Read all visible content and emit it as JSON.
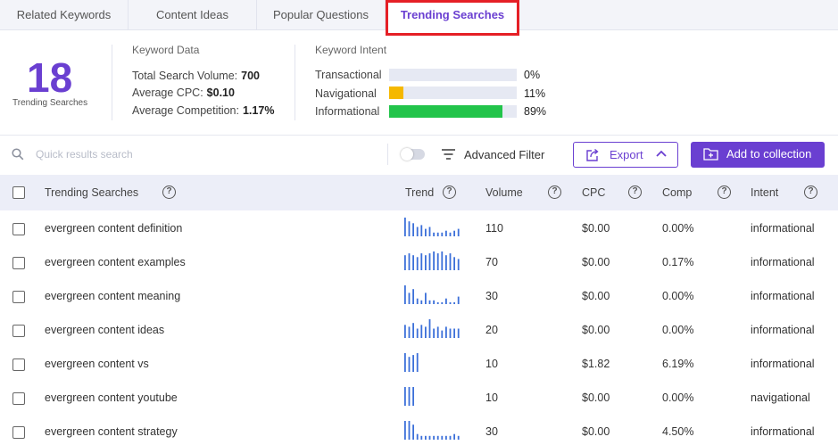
{
  "tabs": [
    {
      "label": "Related Keywords"
    },
    {
      "label": "Content Ideas"
    },
    {
      "label": "Popular Questions"
    },
    {
      "label": "Trending Searches"
    }
  ],
  "summary": {
    "count": "18",
    "label": "Trending Searches"
  },
  "keyword_data": {
    "title": "Keyword Data",
    "volume_label": "Total Search Volume:",
    "volume_value": "700",
    "cpc_label": "Average CPC:",
    "cpc_value": "$0.10",
    "comp_label": "Average Competition:",
    "comp_value": "1.17%"
  },
  "keyword_intent": {
    "title": "Keyword Intent",
    "items": [
      {
        "label": "Transactional",
        "pct": "0%",
        "fraction": 0.0,
        "color": "#f5b800"
      },
      {
        "label": "Navigational",
        "pct": "11%",
        "fraction": 0.11,
        "color": "#f5b800"
      },
      {
        "label": "Informational",
        "pct": "89%",
        "fraction": 0.89,
        "color": "#22c44a"
      }
    ]
  },
  "toolbar": {
    "search_placeholder": "Quick results search",
    "filter_label": "Advanced Filter",
    "export_label": "Export",
    "collection_label": "Add to collection"
  },
  "table": {
    "headers": {
      "keyword": "Trending Searches",
      "trend": "Trend",
      "volume": "Volume",
      "cpc": "CPC",
      "comp": "Comp",
      "intent": "Intent"
    },
    "rows": [
      {
        "keyword": "evergreen content definition",
        "volume": "110",
        "cpc": "$0.00",
        "comp": "0.00%",
        "intent": "informational",
        "trend": [
          10,
          8,
          7,
          5,
          6,
          4,
          5,
          2,
          2,
          2,
          3,
          2,
          3,
          4
        ]
      },
      {
        "keyword": "evergreen content examples",
        "volume": "70",
        "cpc": "$0.00",
        "comp": "0.17%",
        "intent": "informational",
        "trend": [
          8,
          9,
          8,
          7,
          9,
          8,
          9,
          10,
          9,
          10,
          8,
          9,
          7,
          6
        ]
      },
      {
        "keyword": "evergreen content meaning",
        "volume": "30",
        "cpc": "$0.00",
        "comp": "0.00%",
        "intent": "informational",
        "trend": [
          10,
          6,
          8,
          3,
          2,
          6,
          2,
          2,
          1,
          1,
          3,
          1,
          1,
          4
        ]
      },
      {
        "keyword": "evergreen content ideas",
        "volume": "20",
        "cpc": "$0.00",
        "comp": "0.00%",
        "intent": "informational",
        "trend": [
          7,
          6,
          8,
          5,
          7,
          6,
          10,
          5,
          6,
          4,
          6,
          5,
          5,
          5
        ]
      },
      {
        "keyword": "evergreen content vs",
        "volume": "10",
        "cpc": "$1.82",
        "comp": "6.19%",
        "intent": "informational",
        "trend": [
          10,
          8,
          9,
          10
        ]
      },
      {
        "keyword": "evergreen content youtube",
        "volume": "10",
        "cpc": "$0.00",
        "comp": "0.00%",
        "intent": "navigational",
        "trend": [
          10,
          10,
          10
        ]
      },
      {
        "keyword": "evergreen content strategy",
        "volume": "30",
        "cpc": "$0.00",
        "comp": "4.50%",
        "intent": "informational",
        "trend": [
          10,
          10,
          8,
          3,
          2,
          2,
          2,
          2,
          2,
          2,
          2,
          2,
          3,
          2
        ]
      }
    ]
  },
  "colors": {
    "accent": "#6a3fd1",
    "trend_bar": "#3b6fd9",
    "highlight": "#e51f26"
  }
}
